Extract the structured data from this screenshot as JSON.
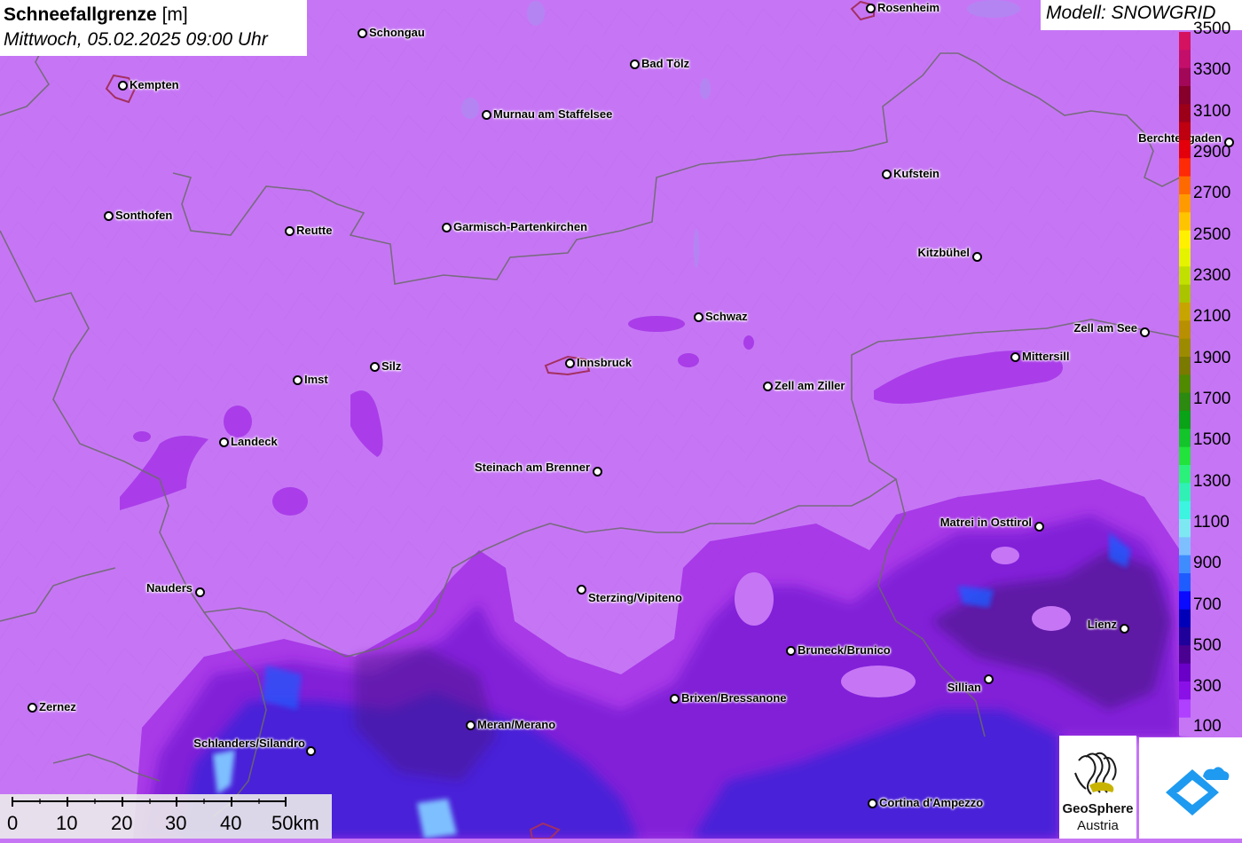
{
  "header": {
    "title_bold": "Schneefallgrenze",
    "title_unit": "[m]",
    "datetime": "Mittwoch, 05.02.2025 09:00 Uhr",
    "model": "Modell: SNOWGRID"
  },
  "cities": [
    {
      "name": "Rosenheim"
    },
    {
      "name": "Schongau"
    },
    {
      "name": "Kempten"
    },
    {
      "name": "Bad Tölz"
    },
    {
      "name": "Murnau am Staffelsee"
    },
    {
      "name": "Berchtesgaden"
    },
    {
      "name": "Kufstein"
    },
    {
      "name": "Sonthofen"
    },
    {
      "name": "Reutte"
    },
    {
      "name": "Garmisch-Partenkirchen"
    },
    {
      "name": "Kitzbühel"
    },
    {
      "name": "Schwaz"
    },
    {
      "name": "Zell am See"
    },
    {
      "name": "Mittersill"
    },
    {
      "name": "Innsbruck"
    },
    {
      "name": "Silz"
    },
    {
      "name": "Imst"
    },
    {
      "name": "Zell am Ziller"
    },
    {
      "name": "Landeck"
    },
    {
      "name": "Steinach am Brenner"
    },
    {
      "name": "Matrei in Osttirol"
    },
    {
      "name": "Nauders"
    },
    {
      "name": "Sterzing/Vipiteno"
    },
    {
      "name": "Lienz"
    },
    {
      "name": "Bruneck/Brunico"
    },
    {
      "name": "Sillian"
    },
    {
      "name": "Brixen/Bressanone"
    },
    {
      "name": "Zernez"
    },
    {
      "name": "Meran/Merano"
    },
    {
      "name": "Schlanders/Silandro"
    },
    {
      "name": "Cortina d'Ampezzo"
    }
  ],
  "legend": {
    "labels": [
      "3500",
      "3300",
      "3100",
      "2900",
      "2700",
      "2500",
      "2300",
      "2100",
      "1900",
      "1700",
      "1500",
      "1300",
      "1100",
      "900",
      "700",
      "500",
      "300",
      "100"
    ],
    "colors": [
      "#d4125f",
      "#c40f6a",
      "#a20857",
      "#86002b",
      "#9c0018",
      "#be0010",
      "#e3000b",
      "#ff2a06",
      "#ff6a00",
      "#ff9b00",
      "#ffc400",
      "#fff000",
      "#e5f200",
      "#c2e000",
      "#aac400",
      "#c8a400",
      "#b88f00",
      "#9c8a00",
      "#7a7a00",
      "#4f8a00",
      "#2c8a10",
      "#0aa216",
      "#13c42a",
      "#22e23c",
      "#2bf07a",
      "#30f0b5",
      "#3cf4e0",
      "#7ee8f2",
      "#7ec0ff",
      "#3f8cff",
      "#1f5cff",
      "#0a0aff",
      "#0000b8",
      "#20009a",
      "#4a0090",
      "#6a00c8",
      "#8a10e8",
      "#b040ff",
      "#c676f5"
    ]
  },
  "scalebar": {
    "ticks": [
      "0",
      "10",
      "20",
      "30",
      "40",
      "50km"
    ]
  },
  "logos": {
    "geosphere_line1": "GeoSphere",
    "geosphere_line2": "Austria"
  }
}
